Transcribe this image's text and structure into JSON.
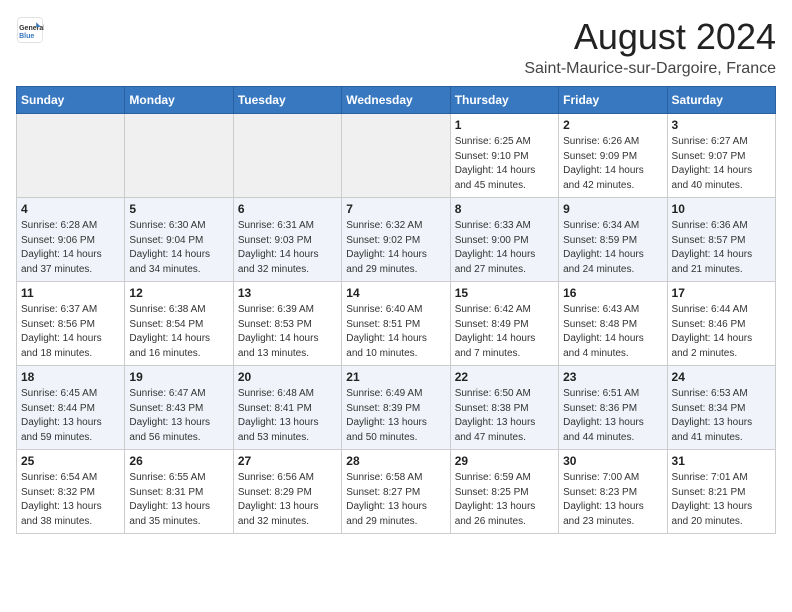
{
  "logo": {
    "line1": "General",
    "line2": "Blue"
  },
  "title": "August 2024",
  "subtitle": "Saint-Maurice-sur-Dargoire, France",
  "days_of_week": [
    "Sunday",
    "Monday",
    "Tuesday",
    "Wednesday",
    "Thursday",
    "Friday",
    "Saturday"
  ],
  "weeks": [
    [
      {
        "day": "",
        "info": ""
      },
      {
        "day": "",
        "info": ""
      },
      {
        "day": "",
        "info": ""
      },
      {
        "day": "",
        "info": ""
      },
      {
        "day": "1",
        "info": "Sunrise: 6:25 AM\nSunset: 9:10 PM\nDaylight: 14 hours\nand 45 minutes."
      },
      {
        "day": "2",
        "info": "Sunrise: 6:26 AM\nSunset: 9:09 PM\nDaylight: 14 hours\nand 42 minutes."
      },
      {
        "day": "3",
        "info": "Sunrise: 6:27 AM\nSunset: 9:07 PM\nDaylight: 14 hours\nand 40 minutes."
      }
    ],
    [
      {
        "day": "4",
        "info": "Sunrise: 6:28 AM\nSunset: 9:06 PM\nDaylight: 14 hours\nand 37 minutes."
      },
      {
        "day": "5",
        "info": "Sunrise: 6:30 AM\nSunset: 9:04 PM\nDaylight: 14 hours\nand 34 minutes."
      },
      {
        "day": "6",
        "info": "Sunrise: 6:31 AM\nSunset: 9:03 PM\nDaylight: 14 hours\nand 32 minutes."
      },
      {
        "day": "7",
        "info": "Sunrise: 6:32 AM\nSunset: 9:02 PM\nDaylight: 14 hours\nand 29 minutes."
      },
      {
        "day": "8",
        "info": "Sunrise: 6:33 AM\nSunset: 9:00 PM\nDaylight: 14 hours\nand 27 minutes."
      },
      {
        "day": "9",
        "info": "Sunrise: 6:34 AM\nSunset: 8:59 PM\nDaylight: 14 hours\nand 24 minutes."
      },
      {
        "day": "10",
        "info": "Sunrise: 6:36 AM\nSunset: 8:57 PM\nDaylight: 14 hours\nand 21 minutes."
      }
    ],
    [
      {
        "day": "11",
        "info": "Sunrise: 6:37 AM\nSunset: 8:56 PM\nDaylight: 14 hours\nand 18 minutes."
      },
      {
        "day": "12",
        "info": "Sunrise: 6:38 AM\nSunset: 8:54 PM\nDaylight: 14 hours\nand 16 minutes."
      },
      {
        "day": "13",
        "info": "Sunrise: 6:39 AM\nSunset: 8:53 PM\nDaylight: 14 hours\nand 13 minutes."
      },
      {
        "day": "14",
        "info": "Sunrise: 6:40 AM\nSunset: 8:51 PM\nDaylight: 14 hours\nand 10 minutes."
      },
      {
        "day": "15",
        "info": "Sunrise: 6:42 AM\nSunset: 8:49 PM\nDaylight: 14 hours\nand 7 minutes."
      },
      {
        "day": "16",
        "info": "Sunrise: 6:43 AM\nSunset: 8:48 PM\nDaylight: 14 hours\nand 4 minutes."
      },
      {
        "day": "17",
        "info": "Sunrise: 6:44 AM\nSunset: 8:46 PM\nDaylight: 14 hours\nand 2 minutes."
      }
    ],
    [
      {
        "day": "18",
        "info": "Sunrise: 6:45 AM\nSunset: 8:44 PM\nDaylight: 13 hours\nand 59 minutes."
      },
      {
        "day": "19",
        "info": "Sunrise: 6:47 AM\nSunset: 8:43 PM\nDaylight: 13 hours\nand 56 minutes."
      },
      {
        "day": "20",
        "info": "Sunrise: 6:48 AM\nSunset: 8:41 PM\nDaylight: 13 hours\nand 53 minutes."
      },
      {
        "day": "21",
        "info": "Sunrise: 6:49 AM\nSunset: 8:39 PM\nDaylight: 13 hours\nand 50 minutes."
      },
      {
        "day": "22",
        "info": "Sunrise: 6:50 AM\nSunset: 8:38 PM\nDaylight: 13 hours\nand 47 minutes."
      },
      {
        "day": "23",
        "info": "Sunrise: 6:51 AM\nSunset: 8:36 PM\nDaylight: 13 hours\nand 44 minutes."
      },
      {
        "day": "24",
        "info": "Sunrise: 6:53 AM\nSunset: 8:34 PM\nDaylight: 13 hours\nand 41 minutes."
      }
    ],
    [
      {
        "day": "25",
        "info": "Sunrise: 6:54 AM\nSunset: 8:32 PM\nDaylight: 13 hours\nand 38 minutes."
      },
      {
        "day": "26",
        "info": "Sunrise: 6:55 AM\nSunset: 8:31 PM\nDaylight: 13 hours\nand 35 minutes."
      },
      {
        "day": "27",
        "info": "Sunrise: 6:56 AM\nSunset: 8:29 PM\nDaylight: 13 hours\nand 32 minutes."
      },
      {
        "day": "28",
        "info": "Sunrise: 6:58 AM\nSunset: 8:27 PM\nDaylight: 13 hours\nand 29 minutes."
      },
      {
        "day": "29",
        "info": "Sunrise: 6:59 AM\nSunset: 8:25 PM\nDaylight: 13 hours\nand 26 minutes."
      },
      {
        "day": "30",
        "info": "Sunrise: 7:00 AM\nSunset: 8:23 PM\nDaylight: 13 hours\nand 23 minutes."
      },
      {
        "day": "31",
        "info": "Sunrise: 7:01 AM\nSunset: 8:21 PM\nDaylight: 13 hours\nand 20 minutes."
      }
    ]
  ]
}
